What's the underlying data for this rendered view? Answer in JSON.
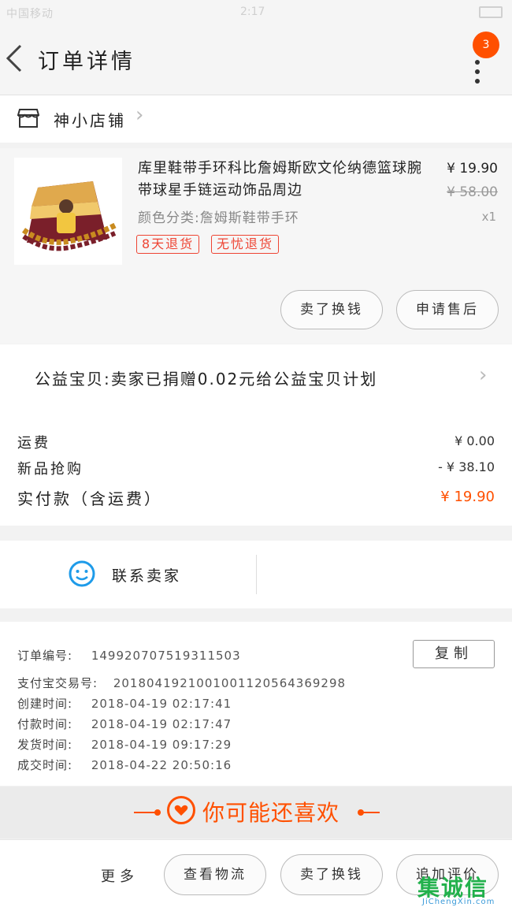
{
  "status_bar": {
    "left": "中国移动",
    "time": "2:17"
  },
  "header": {
    "title": "订单详情",
    "badge_count": "3"
  },
  "shop": {
    "name": "神小店铺"
  },
  "item": {
    "title": "库里鞋带手环科比詹姆斯欧文伦纳德篮球腕带球星手链运动饰品周边",
    "sku": "颜色分类:詹姆斯鞋带手环",
    "price": "¥ 19.90",
    "original_price": "¥ 58.00",
    "quantity": "x1",
    "tags": [
      "8天退货",
      "无忧退货"
    ],
    "buttons": [
      "卖了换钱",
      "申请售后"
    ]
  },
  "charity": {
    "text": "公益宝贝:卖家已捐赠0.02元给公益宝贝计划"
  },
  "cost": {
    "shipping_label": "运费",
    "shipping_value": "¥ 0.00",
    "promo_label": "新品抢购",
    "promo_value": "- ¥ 38.10",
    "paid_label": "实付款（含运费）",
    "paid_value": "¥ 19.90"
  },
  "contact": {
    "label": "联系卖家"
  },
  "order_info": {
    "order_no_label": "订单编号:",
    "order_no": "149920707519311503",
    "alipay_label": "支付宝交易号:",
    "alipay_no": "2018041921001001120564369298",
    "created_label": "创建时间:",
    "created": "2018-04-19 02:17:41",
    "paid_label": "付款时间:",
    "paid": "2018-04-19 02:17:47",
    "shipped_label": "发货时间:",
    "shipped": "2018-04-19 09:17:29",
    "completed_label": "成交时间:",
    "completed": "2018-04-22 20:50:16",
    "copy_button": "复制"
  },
  "recommend": {
    "title": "你可能还喜欢"
  },
  "bottom_bar": {
    "more": "更多",
    "buttons": [
      "查看物流",
      "卖了换钱",
      "追加评价"
    ]
  },
  "watermark": {
    "big": "集诚信",
    "small": "JiChengXin.com"
  },
  "colors": {
    "accent": "#ff5000",
    "tag_red": "#e43333",
    "contact_blue": "#1e9be9"
  }
}
